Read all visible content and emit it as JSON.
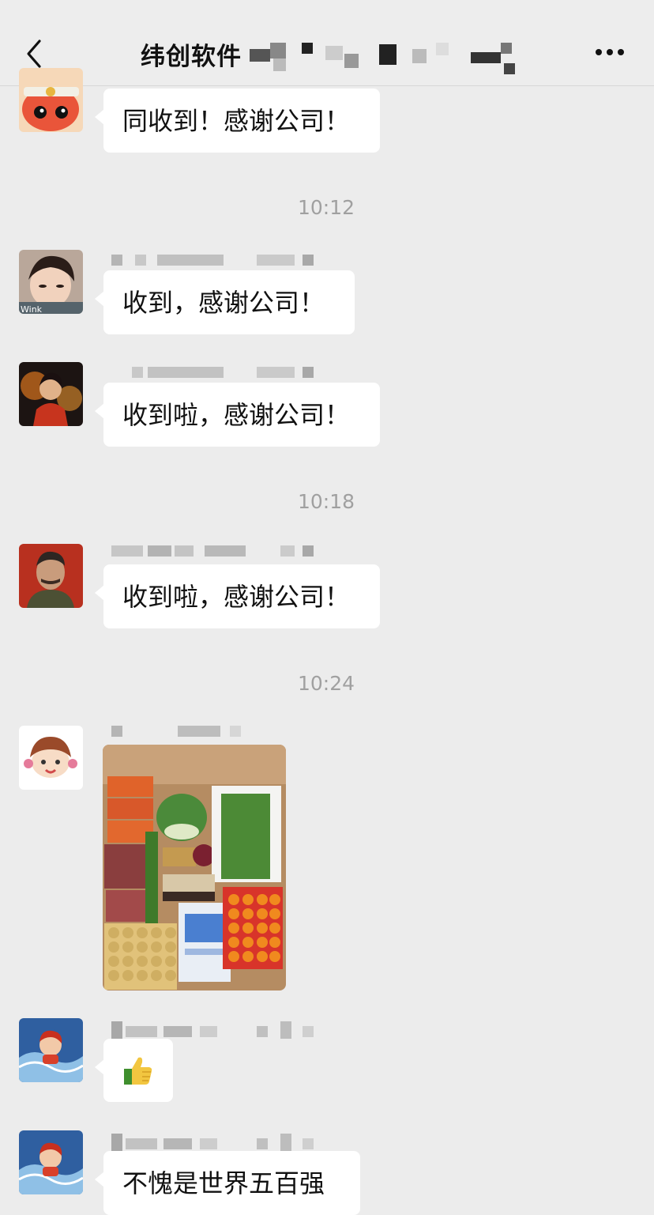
{
  "header": {
    "title": "纬创软件"
  },
  "messages": [
    {
      "text": "同收到！感谢公司！"
    },
    {
      "time": "10:12"
    },
    {
      "text": "收到，感谢公司！",
      "avatar_badge": "Wink"
    },
    {
      "text": "收到啦，感谢公司！"
    },
    {
      "time": "10:18"
    },
    {
      "text": "收到啦，感谢公司！"
    },
    {
      "time": "10:24"
    },
    {
      "image": "grocery-photo"
    },
    {
      "emoji": "thumbs-up-icon"
    },
    {
      "text": "不愧是世界五百强"
    }
  ],
  "colors": {
    "background": "#ececec",
    "bubble": "#ffffff",
    "timestamp": "#a0a0a0"
  },
  "icons": [
    "back-arrow-icon",
    "more-dots-icon",
    "thumbs-up-icon"
  ]
}
